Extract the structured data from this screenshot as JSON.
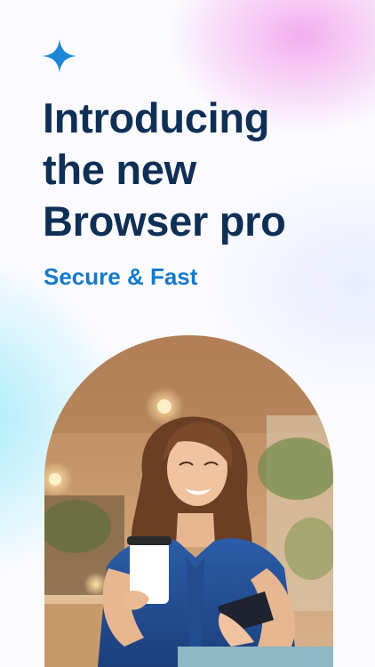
{
  "promo": {
    "headline_lines": [
      "Introducing",
      "the new",
      "Browser pro"
    ],
    "subtitle": "Secure & Fast"
  },
  "icons": {
    "sparkle": "sparkle-icon"
  },
  "colors": {
    "headline": "#0f2f55",
    "accent": "#1579c9",
    "sparkle": "#1d86d8",
    "gradient_pink": "#f2a0ec",
    "gradient_cyan": "#96e8fa"
  }
}
